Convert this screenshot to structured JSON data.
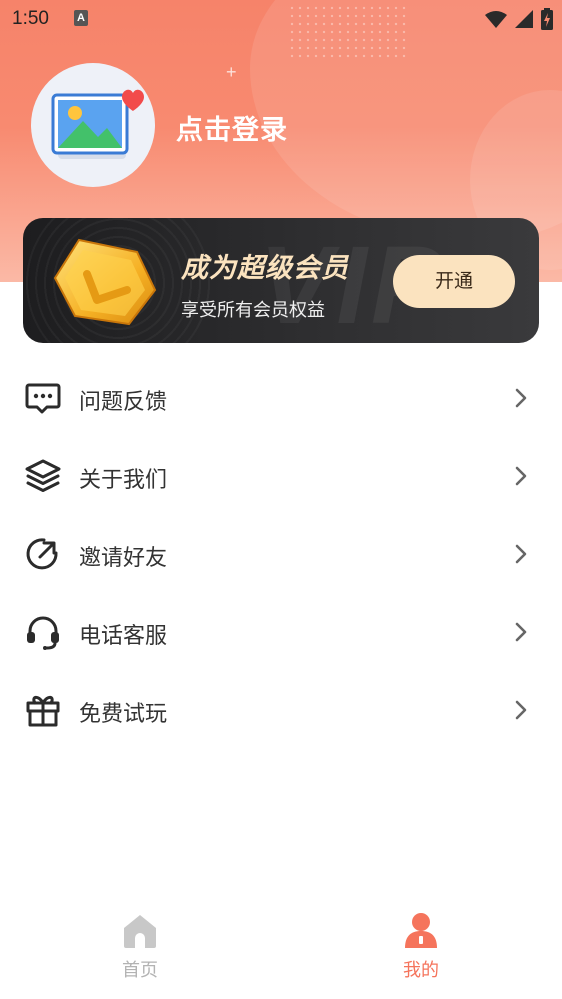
{
  "status_bar": {
    "time": "1:50",
    "notification_icon": "a-badge-icon",
    "icons": [
      "wifi-icon",
      "cell-signal-icon",
      "battery-charging-icon"
    ]
  },
  "profile": {
    "avatar_icon": "picture-heart-icon",
    "login_label": "点击登录"
  },
  "vip": {
    "title": "成为超级会员",
    "subtitle": "享受所有会员权益",
    "button_label": "开通",
    "watermark": "VIP",
    "badge_icon": "gold-crown-badge-icon"
  },
  "menu": {
    "items": [
      {
        "label": "问题反馈",
        "icon": "feedback-message-icon"
      },
      {
        "label": "关于我们",
        "icon": "layers-icon"
      },
      {
        "label": "邀请好友",
        "icon": "share-arrow-icon"
      },
      {
        "label": "电话客服",
        "icon": "headset-icon"
      },
      {
        "label": "免费试玩",
        "icon": "gift-icon"
      }
    ]
  },
  "tabbar": {
    "tabs": [
      {
        "label": "首页",
        "icon": "home-icon",
        "active": false
      },
      {
        "label": "我的",
        "icon": "person-icon",
        "active": true
      }
    ]
  },
  "colors": {
    "accent": "#f5745c",
    "header_start": "#f6836a",
    "vip_gold": "#fbe3bf",
    "vip_card": "#2a2a2c",
    "text_primary": "#333333",
    "tab_inactive": "#b3b3b3"
  }
}
